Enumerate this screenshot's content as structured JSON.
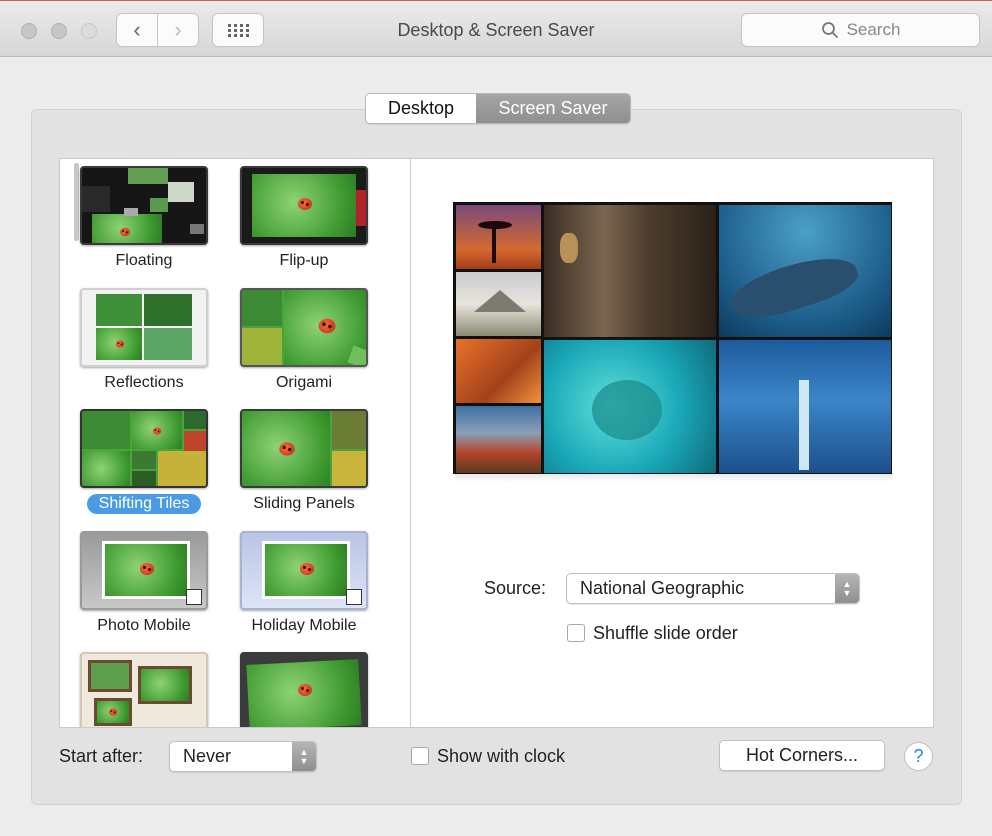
{
  "window": {
    "title": "Desktop & Screen Saver"
  },
  "toolbar": {
    "back_glyph": "‹",
    "forward_glyph": "›",
    "search_placeholder": "Search"
  },
  "tabs": [
    {
      "label": "Desktop",
      "selected": false
    },
    {
      "label": "Screen Saver",
      "selected": true
    }
  ],
  "modules": [
    {
      "label": "Floating",
      "selected": false
    },
    {
      "label": "Flip-up",
      "selected": false
    },
    {
      "label": "Reflections",
      "selected": false
    },
    {
      "label": "Origami",
      "selected": false
    },
    {
      "label": "Shifting Tiles",
      "selected": true
    },
    {
      "label": "Sliding Panels",
      "selected": false
    },
    {
      "label": "Photo Mobile",
      "selected": false
    },
    {
      "label": "Holiday Mobile",
      "selected": false
    }
  ],
  "options": {
    "source_label": "Source:",
    "source_value": "National Geographic",
    "shuffle_label": "Shuffle slide order",
    "shuffle_checked": false
  },
  "footer": {
    "start_after_label": "Start after:",
    "start_after_value": "Never",
    "show_clock_label": "Show with clock",
    "show_clock_checked": false,
    "hot_corners_label": "Hot Corners...",
    "help_glyph": "?"
  },
  "colors": {
    "selection": "#4a9be3",
    "window_bg": "#ececec",
    "help_accent": "#2f7de1"
  }
}
